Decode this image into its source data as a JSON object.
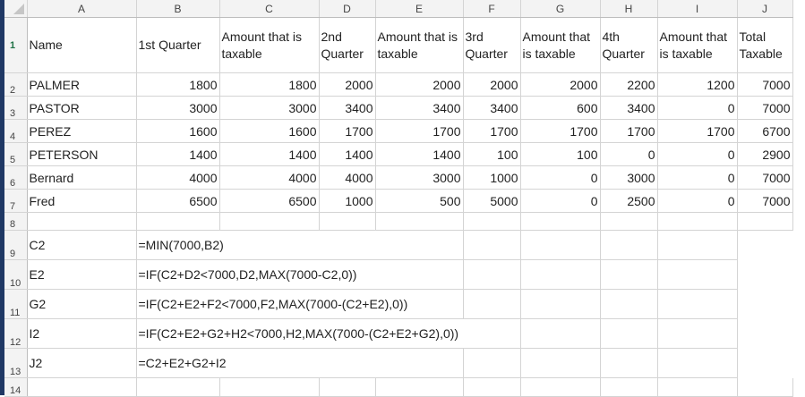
{
  "columns": [
    "A",
    "B",
    "C",
    "D",
    "E",
    "F",
    "G",
    "H",
    "I",
    "J"
  ],
  "row_numbers": [
    "1",
    "2",
    "3",
    "4",
    "5",
    "6",
    "7",
    "8",
    "9",
    "10",
    "11",
    "12",
    "13",
    "14"
  ],
  "headers": [
    "Name",
    "1st Quarter",
    "Amount that is taxable",
    "2nd Quarter",
    "Amount that is taxable",
    "3rd Quarter",
    "Amount that is taxable",
    "4th Quarter",
    "Amount that is taxable",
    "Total Taxable"
  ],
  "rows": [
    [
      "PALMER",
      "1800",
      "1800",
      "2000",
      "2000",
      "2000",
      "2000",
      "2200",
      "1200",
      "7000"
    ],
    [
      "PASTOR",
      "3000",
      "3000",
      "3400",
      "3400",
      "3400",
      "600",
      "3400",
      "0",
      "7000"
    ],
    [
      "PEREZ",
      "1600",
      "1600",
      "1700",
      "1700",
      "1700",
      "1700",
      "1700",
      "1700",
      "6700"
    ],
    [
      "PETERSON",
      "1400",
      "1400",
      "1400",
      "1400",
      "100",
      "100",
      "0",
      "0",
      "2900"
    ],
    [
      "Bernard",
      "4000",
      "4000",
      "4000",
      "3000",
      "1000",
      "0",
      "3000",
      "0",
      "7000"
    ],
    [
      "Fred",
      "6500",
      "6500",
      "1000",
      "500",
      "5000",
      "0",
      "2500",
      "0",
      "7000"
    ]
  ],
  "formulas": [
    {
      "cell": "C2",
      "formula": "=MIN(7000,B2)"
    },
    {
      "cell": "E2",
      "formula": "=IF(C2+D2<7000,D2,MAX(7000-C2,0))"
    },
    {
      "cell": "G2",
      "formula": "=IF(C2+E2+F2<7000,F2,MAX(7000-(C2+E2),0))"
    },
    {
      "cell": "I2",
      "formula": "=IF(C2+E2+G2+H2<7000,H2,MAX(7000-(C2+E2+G2),0))"
    },
    {
      "cell": "J2",
      "formula": "=C2+E2+G2+I2"
    }
  ]
}
